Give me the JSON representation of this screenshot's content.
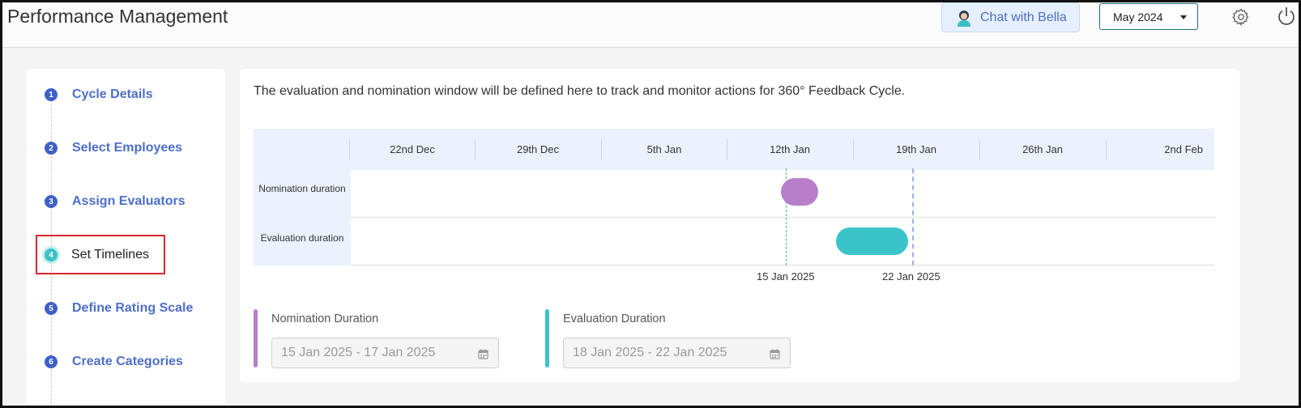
{
  "header": {
    "title": "Performance Management",
    "chat_label": "Chat with Bella",
    "month": "May 2024"
  },
  "steps": [
    {
      "num": "1",
      "label": "Cycle Details"
    },
    {
      "num": "2",
      "label": "Select Employees"
    },
    {
      "num": "3",
      "label": "Assign Evaluators"
    },
    {
      "num": "4",
      "label": "Set Timelines",
      "active": true
    },
    {
      "num": "5",
      "label": "Define Rating Scale"
    },
    {
      "num": "6",
      "label": "Create Categories"
    }
  ],
  "main": {
    "intro": "The evaluation and nomination window will be defined here to track and monitor actions for 360° Feedback Cycle.",
    "weeks": [
      "22nd Dec",
      "29th Dec",
      "5th Jan",
      "12th Jan",
      "19th Jan",
      "26th Jan",
      "2nd Feb"
    ],
    "rows": [
      "Nomination duration",
      "Evaluation duration"
    ],
    "marker_labels": [
      "15 Jan 2025",
      "22 Jan 2025"
    ],
    "nomination": {
      "title": "Nomination Duration",
      "value": "15 Jan 2025 - 17 Jan 2025",
      "color": "#b77fc9"
    },
    "evaluation": {
      "title": "Evaluation Duration",
      "value": "18 Jan 2025 - 22 Jan 2025",
      "color": "#3bc3ca"
    }
  },
  "colors": {
    "accent": "#4d6fc9",
    "highlight": "#d8272e"
  }
}
